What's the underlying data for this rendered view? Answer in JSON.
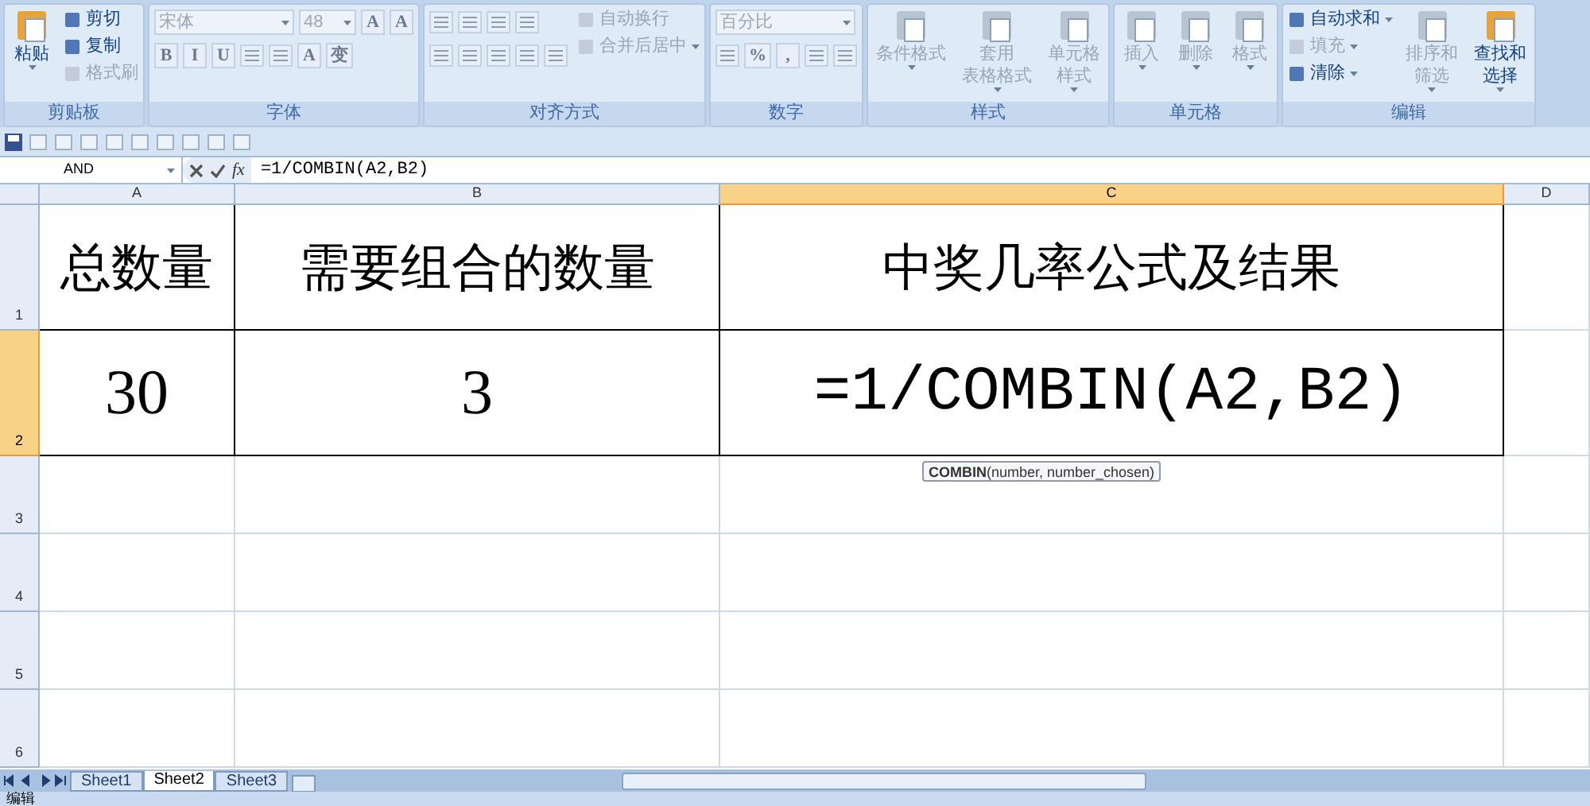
{
  "ribbon": {
    "groups": [
      {
        "label": "剪贴板",
        "columns": [
          [
            {
              "kind": "large",
              "lines": [
                "粘贴"
              ],
              "caret": true,
              "disabled": false
            }
          ],
          [
            {
              "kind": "small",
              "label": "剪切",
              "caret": false,
              "disabled": false
            },
            {
              "kind": "small",
              "label": "复制",
              "caret": false,
              "disabled": false
            },
            {
              "kind": "small",
              "label": "格式刷",
              "caret": false,
              "disabled": true
            }
          ]
        ]
      },
      {
        "label": "字体",
        "columns": [
          [
            {
              "kind": "row",
              "items": [
                {
                  "kind": "combo",
                  "value": "宋体",
                  "wide": true
                },
                {
                  "kind": "combo",
                  "value": "48",
                  "wide": false
                },
                {
                  "kind": "glyph",
                  "label": "A"
                },
                {
                  "kind": "glyph",
                  "label": "A"
                }
              ]
            },
            {
              "kind": "row",
              "items": [
                {
                  "kind": "glyph",
                  "label": "B"
                },
                {
                  "kind": "glyph",
                  "label": "I"
                },
                {
                  "kind": "glyph",
                  "label": "U"
                },
                {
                  "kind": "icon"
                },
                {
                  "kind": "icon"
                },
                {
                  "kind": "glyph",
                  "label": "A"
                },
                {
                  "kind": "glyph",
                  "label": "变"
                }
              ]
            }
          ]
        ]
      },
      {
        "label": "对齐方式",
        "columns": [
          [
            {
              "kind": "row",
              "items": [
                {
                  "kind": "icon"
                },
                {
                  "kind": "icon"
                },
                {
                  "kind": "icon"
                },
                {
                  "kind": "icon"
                }
              ]
            },
            {
              "kind": "row",
              "items": [
                {
                  "kind": "icon"
                },
                {
                  "kind": "icon"
                },
                {
                  "kind": "icon"
                },
                {
                  "kind": "icon"
                },
                {
                  "kind": "icon"
                }
              ]
            }
          ],
          [
            {
              "kind": "small",
              "label": "自动换行",
              "caret": false,
              "disabled": true
            },
            {
              "kind": "small",
              "label": "合并后居中",
              "caret": true,
              "disabled": true
            }
          ]
        ]
      },
      {
        "label": "数字",
        "columns": [
          [
            {
              "kind": "row",
              "items": [
                {
                  "kind": "combo",
                  "value": "百分比",
                  "wide": true
                }
              ]
            },
            {
              "kind": "row",
              "items": [
                {
                  "kind": "icon"
                },
                {
                  "kind": "glyph",
                  "label": "%"
                },
                {
                  "kind": "glyph",
                  "label": ","
                },
                {
                  "kind": "icon"
                },
                {
                  "kind": "icon"
                }
              ]
            }
          ]
        ]
      },
      {
        "label": "样式",
        "columns": [
          [
            {
              "kind": "large",
              "lines": [
                "条件格式"
              ],
              "caret": true,
              "disabled": true
            }
          ],
          [
            {
              "kind": "large",
              "lines": [
                "套用",
                "表格格式"
              ],
              "caret": true,
              "disabled": true
            }
          ],
          [
            {
              "kind": "large",
              "lines": [
                "单元格",
                "样式"
              ],
              "caret": true,
              "disabled": true
            }
          ]
        ]
      },
      {
        "label": "单元格",
        "columns": [
          [
            {
              "kind": "large",
              "lines": [
                "插入"
              ],
              "caret": true,
              "disabled": true
            }
          ],
          [
            {
              "kind": "large",
              "lines": [
                "删除"
              ],
              "caret": true,
              "disabled": true
            }
          ],
          [
            {
              "kind": "large",
              "lines": [
                "格式"
              ],
              "caret": true,
              "disabled": true
            }
          ]
        ]
      },
      {
        "label": "编辑",
        "columns": [
          [
            {
              "kind": "small",
              "label": "自动求和",
              "caret": true,
              "disabled": false
            },
            {
              "kind": "small",
              "label": "填充",
              "caret": true,
              "disabled": true
            },
            {
              "kind": "small",
              "label": "清除",
              "caret": true,
              "disabled": false
            }
          ],
          [
            {
              "kind": "large",
              "lines": [
                "排序和",
                "筛选"
              ],
              "caret": true,
              "disabled": true
            }
          ],
          [
            {
              "kind": "large",
              "lines": [
                "查找和",
                "选择"
              ],
              "caret": true,
              "disabled": false
            }
          ]
        ]
      }
    ]
  },
  "formula_bar": {
    "name_box": "AND",
    "function_button": "fx",
    "formula": "=1/COMBIN(A2,B2)"
  },
  "sheet": {
    "columns": [
      {
        "label": "A",
        "selected": false
      },
      {
        "label": "B",
        "selected": false
      },
      {
        "label": "C",
        "selected": true
      },
      {
        "label": "D",
        "selected": false
      }
    ],
    "rows": [
      {
        "label": "1",
        "selected": false,
        "cells": [
          "总数量",
          "需要组合的数量",
          "中奖几率公式及结果"
        ]
      },
      {
        "label": "2",
        "selected": true,
        "cells": [
          "30",
          "3",
          "=1/COMBIN(A2,B2)"
        ]
      },
      {
        "label": "3",
        "selected": false,
        "cells": []
      },
      {
        "label": "4",
        "selected": false,
        "cells": []
      },
      {
        "label": "5",
        "selected": false,
        "cells": []
      },
      {
        "label": "6",
        "selected": false,
        "cells": []
      }
    ],
    "tooltip": "**COMBIN**(number, number_chosen)"
  },
  "sheet_tabs": [
    {
      "label": "Sheet1",
      "selected": false
    },
    {
      "label": "Sheet2",
      "selected": true
    },
    {
      "label": "Sheet3",
      "selected": false
    }
  ],
  "status_bar": {
    "mode": "编辑"
  }
}
